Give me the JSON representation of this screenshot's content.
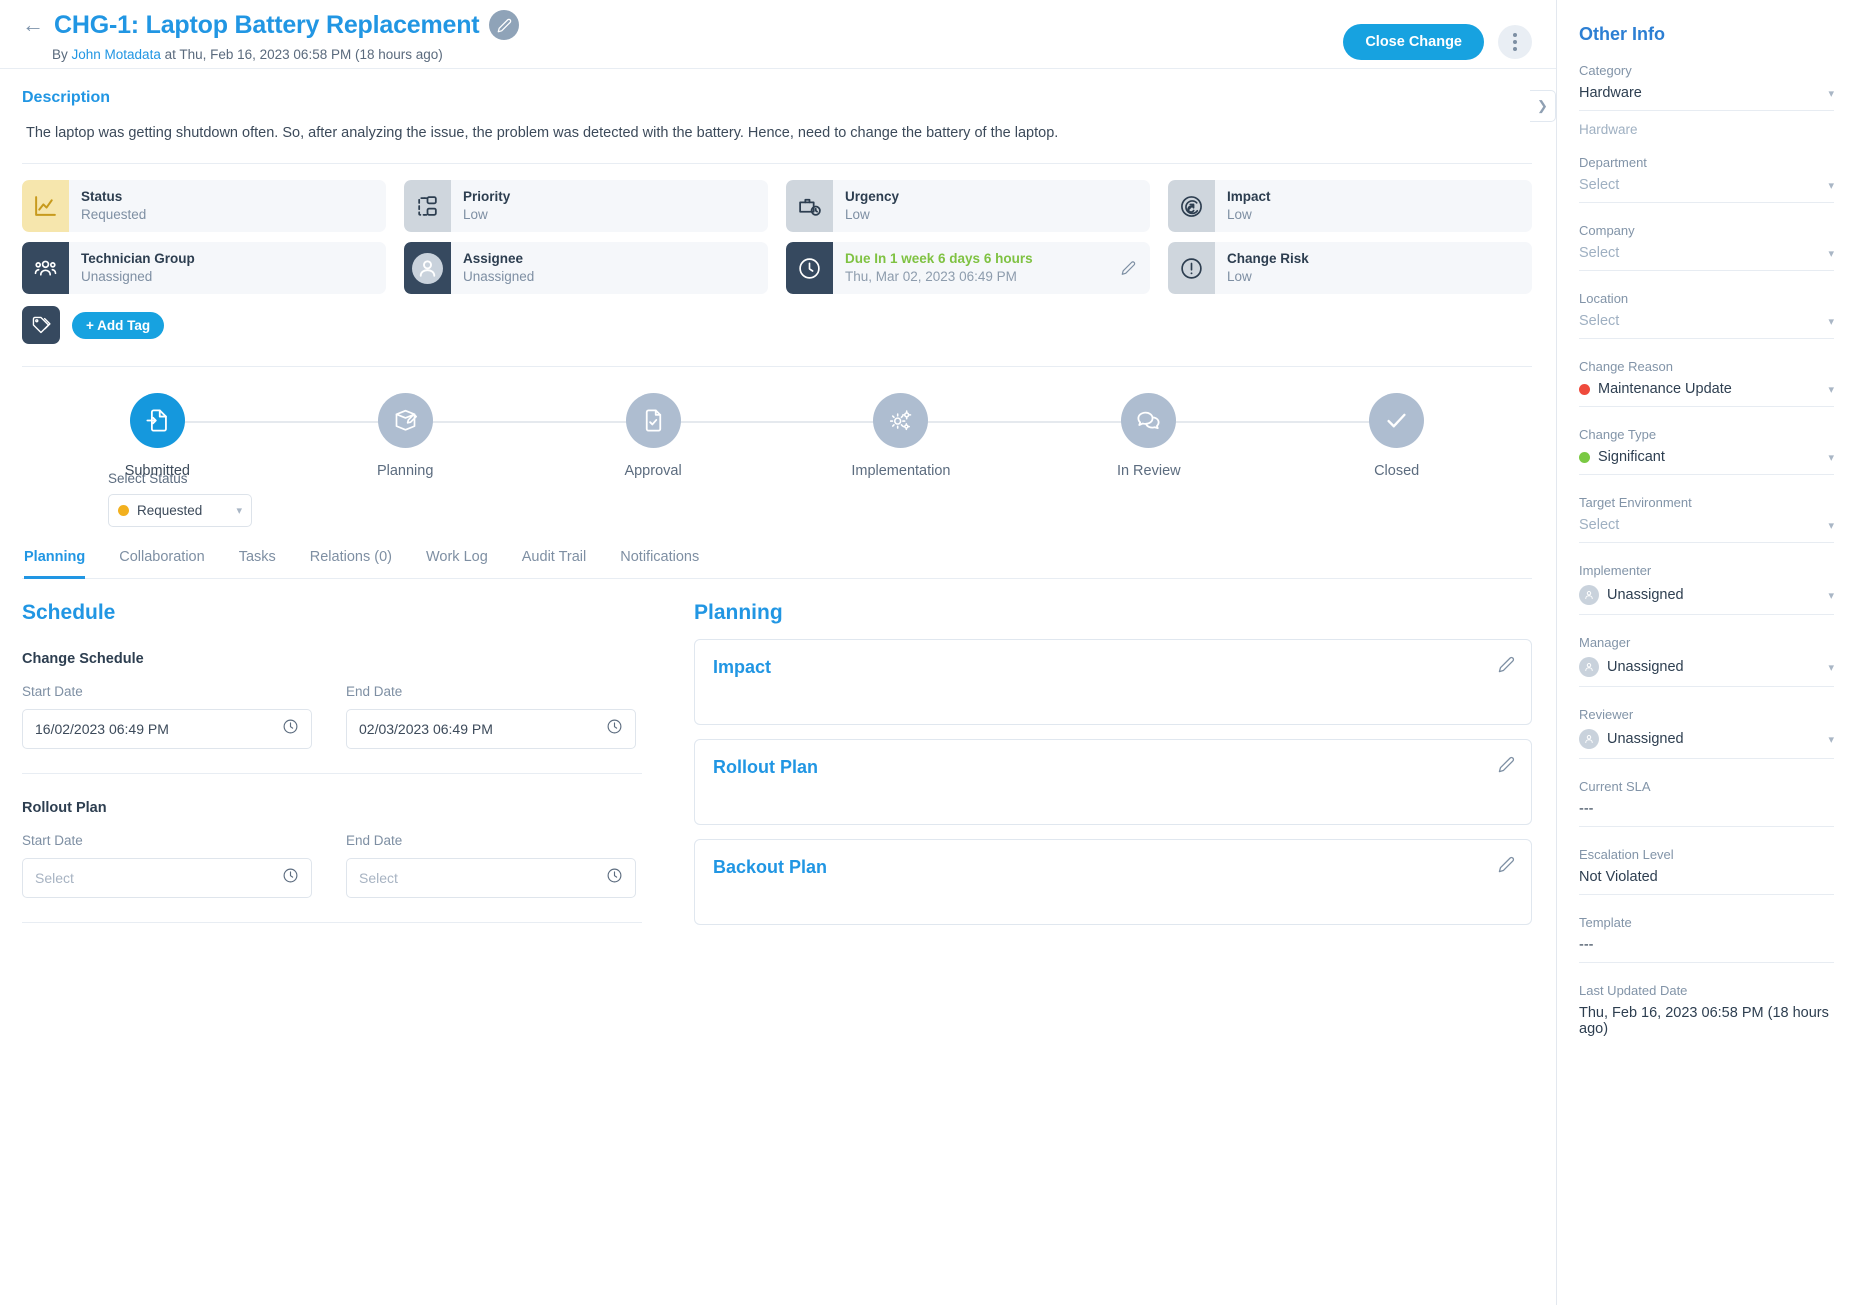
{
  "header": {
    "back_icon": "arrow-left-icon",
    "title": "CHG-1: Laptop Battery Replacement",
    "edit_icon": "pencil-icon",
    "byline_prefix": "By ",
    "byline_author": "John Motadata",
    "byline_suffix": " at Thu, Feb 16, 2023 06:58 PM (18 hours ago)",
    "close_button": "Close Change",
    "kebab_icon": "more-vertical-icon"
  },
  "description": {
    "title": "Description",
    "body": "The laptop was getting shutdown often. So, after analyzing the issue, the problem was detected with the battery. Hence, need to change the battery of the laptop."
  },
  "info_cards": [
    {
      "label": "Status",
      "value": "Requested",
      "icon": "chart-line-icon",
      "tone": "yellow"
    },
    {
      "label": "Priority",
      "value": "Low",
      "icon": "priority-icon",
      "tone": "grey"
    },
    {
      "label": "Urgency",
      "value": "Low",
      "icon": "briefcase-clock-icon",
      "tone": "grey"
    },
    {
      "label": "Impact",
      "value": "Low",
      "icon": "target-impact-icon",
      "tone": "grey"
    },
    {
      "label": "Technician Group",
      "value": "Unassigned",
      "icon": "users-group-icon",
      "tone": "dark"
    },
    {
      "label": "Assignee",
      "value": "Unassigned",
      "icon": "user-avatar-icon",
      "tone": "dark"
    },
    {
      "label": "Due In 1 week 6 days 6 hours",
      "value": "Thu, Mar 02, 2023 06:49 PM",
      "icon": "clock-icon",
      "tone": "dark",
      "due": true,
      "edit_icon": "pencil-icon"
    },
    {
      "label": "Change Risk",
      "value": "Low",
      "icon": "alert-circle-icon",
      "tone": "grey"
    }
  ],
  "tags": {
    "icon": "tags-icon",
    "add_label": "+ Add Tag"
  },
  "stepper": {
    "steps": [
      {
        "name": "Submitted",
        "icon": "submit-doc-icon",
        "active": true
      },
      {
        "name": "Planning",
        "icon": "plan-write-icon",
        "active": false
      },
      {
        "name": "Approval",
        "icon": "doc-check-icon",
        "active": false
      },
      {
        "name": "Implementation",
        "icon": "gears-icon",
        "active": false
      },
      {
        "name": "In Review",
        "icon": "chat-bubbles-icon",
        "active": false
      },
      {
        "name": "Closed",
        "icon": "check-icon",
        "active": false
      }
    ],
    "select_status_label": "Select Status",
    "selected_status": "Requested",
    "selected_status_color": "#f2b01e",
    "chevron_icon": "chevron-down-icon"
  },
  "tabs": [
    {
      "label": "Planning",
      "selected": true
    },
    {
      "label": "Collaboration",
      "selected": false
    },
    {
      "label": "Tasks",
      "selected": false
    },
    {
      "label": "Relations (0)",
      "selected": false
    },
    {
      "label": "Work Log",
      "selected": false
    },
    {
      "label": "Audit Trail",
      "selected": false
    },
    {
      "label": "Notifications",
      "selected": false
    }
  ],
  "schedule": {
    "heading": "Schedule",
    "change_schedule_label": "Change Schedule",
    "change_start_label": "Start Date",
    "change_start_value": "16/02/2023 06:49 PM",
    "change_end_label": "End Date",
    "change_end_value": "02/03/2023 06:49 PM",
    "rollout_label": "Rollout Plan",
    "rollout_start_label": "Start Date",
    "rollout_start_placeholder": "Select",
    "rollout_end_label": "End Date",
    "rollout_end_placeholder": "Select",
    "clock_icon": "clock-icon"
  },
  "planning": {
    "heading": "Planning",
    "boxes": [
      {
        "title": "Impact",
        "edit_icon": "pencil-icon",
        "content": ""
      },
      {
        "title": "Rollout Plan",
        "edit_icon": "pencil-icon",
        "content": ""
      },
      {
        "title": "Backout Plan",
        "edit_icon": "pencil-icon",
        "content": ""
      }
    ]
  },
  "collapse_handle_icon": "chevron-right-icon",
  "other_info": {
    "heading": "Other Info",
    "fields": [
      {
        "label": "Category",
        "value": "Hardware",
        "type": "select",
        "sub": "Hardware"
      },
      {
        "label": "Department",
        "value": "Select",
        "type": "select",
        "placeholder": true
      },
      {
        "label": "Company",
        "value": "Select",
        "type": "select",
        "placeholder": true
      },
      {
        "label": "Location",
        "value": "Select",
        "type": "select",
        "placeholder": true
      },
      {
        "label": "Change Reason",
        "value": "Maintenance Update",
        "type": "select-dot",
        "dot": "#ef4a3c"
      },
      {
        "label": "Change Type",
        "value": "Significant",
        "type": "select-dot",
        "dot": "#7ac943"
      },
      {
        "label": "Target Environment",
        "value": "Select",
        "type": "select",
        "placeholder": true
      },
      {
        "label": "Implementer",
        "value": "Unassigned",
        "type": "select-avatar"
      },
      {
        "label": "Manager",
        "value": "Unassigned",
        "type": "select-avatar"
      },
      {
        "label": "Reviewer",
        "value": "Unassigned",
        "type": "select-avatar"
      },
      {
        "label": "Current SLA",
        "value": "---",
        "type": "plain"
      },
      {
        "label": "Escalation Level",
        "value": "Not Violated",
        "type": "plain"
      },
      {
        "label": "Template",
        "value": "---",
        "type": "plain"
      },
      {
        "label": "Last Updated Date",
        "value": "Thu, Feb 16, 2023 06:58 PM (18 hours ago)",
        "type": "plain-last"
      }
    ]
  }
}
